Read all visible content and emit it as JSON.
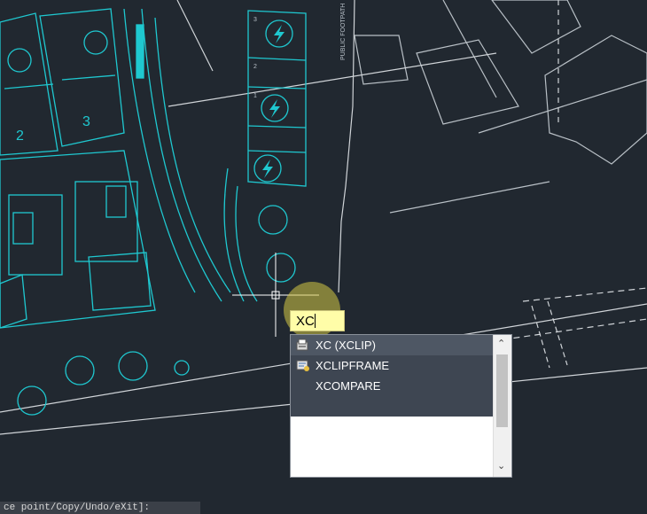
{
  "drawing": {
    "unit_labels": [
      "2",
      "3"
    ],
    "charger_bay_numbers": [
      "3",
      "2",
      "1"
    ],
    "road_label": "PUBLIC FOOTPATH"
  },
  "command": {
    "typed_value": "XC"
  },
  "autocomplete": {
    "items": [
      {
        "label": "XC (XCLIP)",
        "icon": "xclip-icon",
        "selected": true
      },
      {
        "label": "XCLIPFRAME",
        "icon": "xclipframe-icon",
        "selected": false
      },
      {
        "label": "XCOMPARE",
        "icon": "",
        "selected": false
      }
    ],
    "scroll_up_glyph": "⌃",
    "scroll_down_glyph": "⌄"
  },
  "command_line": {
    "prompt": "ce point/Copy/Undo/eXit]:"
  },
  "colors": {
    "background": "#212830",
    "cyan_lines": "#1fc8d0",
    "white_lines": "#e6e6e6",
    "input_bg": "#fffda8",
    "highlight": "#d6c846"
  }
}
